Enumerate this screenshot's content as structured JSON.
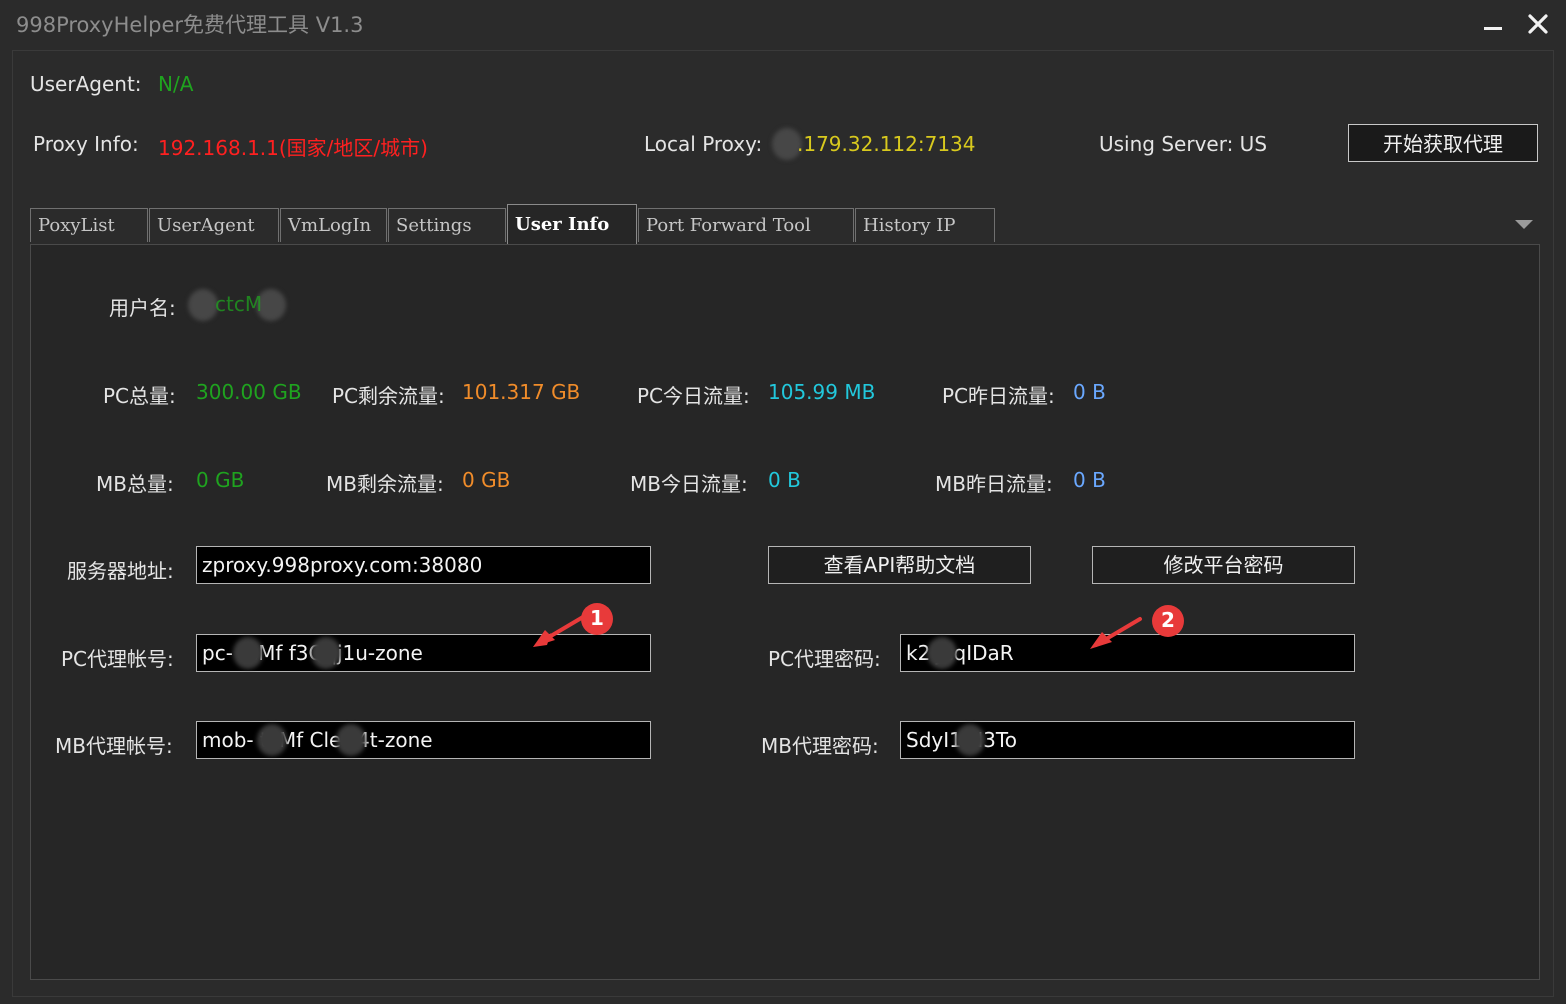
{
  "window": {
    "title": "998ProxyHelper免费代理工具 V1.3"
  },
  "header": {
    "user_agent_label": "UserAgent:",
    "user_agent_value": "N/A",
    "proxy_info_label": "Proxy Info:",
    "proxy_info_value": "192.168.1.1(国家/地区/城市)",
    "local_proxy_label": "Local Proxy:",
    "local_proxy_value": ".179.32.112:7134",
    "using_server_text": "Using Server: US",
    "start_button": "开始获取代理"
  },
  "tabs": [
    {
      "label": "PoxyList"
    },
    {
      "label": "UserAgent"
    },
    {
      "label": "VmLogIn"
    },
    {
      "label": "Settings"
    },
    {
      "label": "User Info"
    },
    {
      "label": "Port Forward Tool"
    },
    {
      "label": "History IP"
    }
  ],
  "user_info": {
    "username_label": "用户名:",
    "username_value": "ctcM",
    "pc_total_label": "PC总量:",
    "pc_total_value": "300.00 GB",
    "pc_remaining_label": "PC剩余流量:",
    "pc_remaining_value": "101.317 GB",
    "pc_today_label": "PC今日流量:",
    "pc_today_value": "105.99 MB",
    "pc_yesterday_label": "PC昨日流量:",
    "pc_yesterday_value": "0 B",
    "mb_total_label": "MB总量:",
    "mb_total_value": "0 GB",
    "mb_remaining_label": "MB剩余流量:",
    "mb_remaining_value": "0 GB",
    "mb_today_label": "MB今日流量:",
    "mb_today_value": "0 B",
    "mb_yesterday_label": "MB昨日流量:",
    "mb_yesterday_value": "0 B",
    "server_label": "服务器地址:",
    "server_value": "zproxy.998proxy.com:38080",
    "api_help_button": "查看API帮助文档",
    "change_password_button": "修改平台密码",
    "pc_account_label": "PC代理帐号:",
    "pc_account_value": "pc-  tcMf  f3Qqj1u-zone",
    "pc_password_label": "PC代理密码:",
    "pc_password_value": "k2  JcqIDaR",
    "mb_account_label": "MB代理帐号:",
    "mb_account_value": "mob-  tcMf  CleO4t-zone",
    "mb_password_label": "MB代理密码:",
    "mb_password_value": "SdyI1  N3To"
  },
  "annotations": [
    {
      "number": "1"
    },
    {
      "number": "2"
    }
  ],
  "colors": {
    "accent_red": "#ff2020",
    "green": "#1fa31f",
    "orange": "#f08c2a",
    "cyan": "#22c8dc",
    "blue": "#6aa8ff"
  }
}
